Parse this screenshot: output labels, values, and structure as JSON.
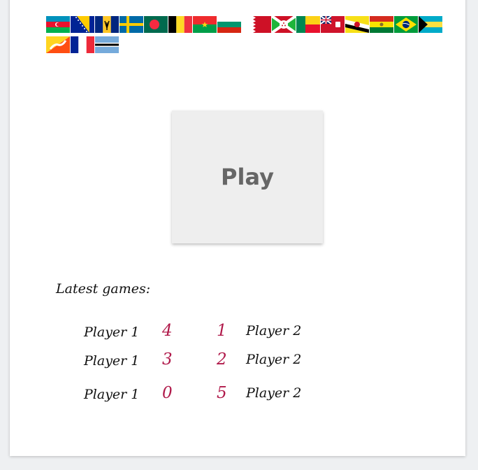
{
  "flags": [
    {
      "country": "Azerbaijan",
      "colors": [
        "#0092bc",
        "#e8112d",
        "#00b04f"
      ]
    },
    {
      "country": "Bosnia and Herzegovina",
      "colors": [
        "#002395",
        "#fecb00",
        "#ffffff"
      ]
    },
    {
      "country": "Barbados",
      "colors": [
        "#00267f",
        "#ffc726",
        "#000000"
      ]
    },
    {
      "country": "Sweden",
      "colors": [
        "#006aa7",
        "#fecc00"
      ]
    },
    {
      "country": "Bangladesh",
      "colors": [
        "#006a4e",
        "#f42a41"
      ]
    },
    {
      "country": "Belgium",
      "colors": [
        "#000000",
        "#fdda24",
        "#ef3340"
      ]
    },
    {
      "country": "Burkina Faso",
      "colors": [
        "#ef2b2d",
        "#009e49",
        "#fcd116"
      ]
    },
    {
      "country": "Bulgaria",
      "colors": [
        "#ffffff",
        "#00966e",
        "#d62612"
      ]
    },
    {
      "country": "Bahrain",
      "colors": [
        "#ffffff",
        "#ce1126"
      ]
    },
    {
      "country": "Burundi",
      "colors": [
        "#ce1126",
        "#1eb53a",
        "#ffffff"
      ]
    },
    {
      "country": "Benin",
      "colors": [
        "#008751",
        "#fcd116",
        "#e8112d"
      ]
    },
    {
      "country": "Bermuda",
      "colors": [
        "#cf142b",
        "#012169",
        "#ffffff"
      ]
    },
    {
      "country": "Brunei",
      "colors": [
        "#f7e017",
        "#ffffff",
        "#000000",
        "#cf1126"
      ]
    },
    {
      "country": "Bolivia",
      "colors": [
        "#d52b1e",
        "#f9e300",
        "#007934"
      ]
    },
    {
      "country": "Brazil",
      "colors": [
        "#009c3b",
        "#ffdf00",
        "#002776"
      ]
    },
    {
      "country": "Bahamas",
      "colors": [
        "#00abc9",
        "#fae042",
        "#000000"
      ]
    },
    {
      "country": "Bhutan",
      "colors": [
        "#ffd520",
        "#ff4e12",
        "#ffffff"
      ]
    },
    {
      "country": "France",
      "colors": [
        "#002395",
        "#ffffff",
        "#ed2939"
      ]
    },
    {
      "country": "Botswana",
      "colors": [
        "#75aadb",
        "#ffffff",
        "#000000"
      ]
    }
  ],
  "play_label": "Play",
  "latest_label": "Latest games:",
  "games": [
    {
      "player1": "Player 1",
      "score1": "4",
      "score2": "1",
      "player2": "Player 2"
    },
    {
      "player1": "Player 1",
      "score1": "3",
      "score2": "2",
      "player2": "Player 2"
    },
    {
      "player1": "Player 1",
      "score1": "0",
      "score2": "5",
      "player2": "Player 2"
    }
  ],
  "accent_color": "#b0194a"
}
